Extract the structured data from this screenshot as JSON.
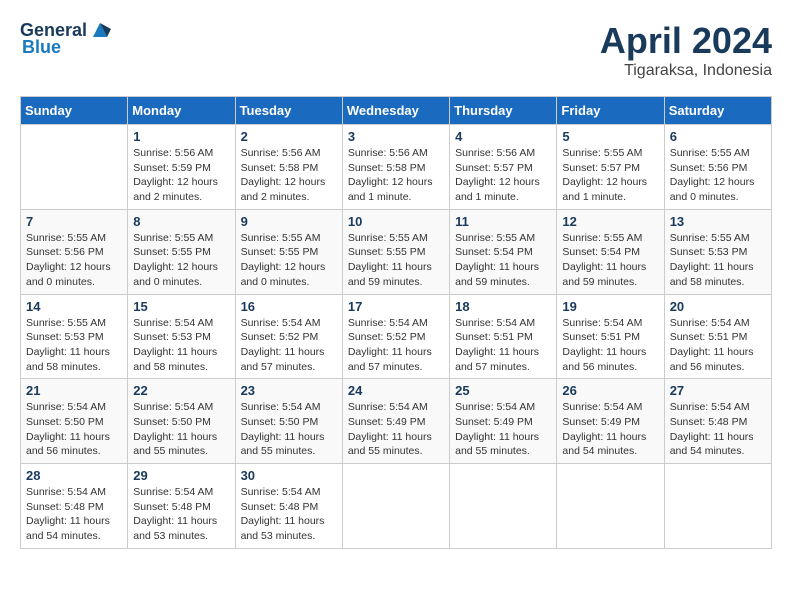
{
  "header": {
    "logo_general": "General",
    "logo_blue": "Blue",
    "month_year": "April 2024",
    "location": "Tigaraksa, Indonesia"
  },
  "days_of_week": [
    "Sunday",
    "Monday",
    "Tuesday",
    "Wednesday",
    "Thursday",
    "Friday",
    "Saturday"
  ],
  "weeks": [
    [
      {
        "day": "",
        "info": ""
      },
      {
        "day": "1",
        "info": "Sunrise: 5:56 AM\nSunset: 5:59 PM\nDaylight: 12 hours\nand 2 minutes."
      },
      {
        "day": "2",
        "info": "Sunrise: 5:56 AM\nSunset: 5:58 PM\nDaylight: 12 hours\nand 2 minutes."
      },
      {
        "day": "3",
        "info": "Sunrise: 5:56 AM\nSunset: 5:58 PM\nDaylight: 12 hours\nand 1 minute."
      },
      {
        "day": "4",
        "info": "Sunrise: 5:56 AM\nSunset: 5:57 PM\nDaylight: 12 hours\nand 1 minute."
      },
      {
        "day": "5",
        "info": "Sunrise: 5:55 AM\nSunset: 5:57 PM\nDaylight: 12 hours\nand 1 minute."
      },
      {
        "day": "6",
        "info": "Sunrise: 5:55 AM\nSunset: 5:56 PM\nDaylight: 12 hours\nand 0 minutes."
      }
    ],
    [
      {
        "day": "7",
        "info": "Sunrise: 5:55 AM\nSunset: 5:56 PM\nDaylight: 12 hours\nand 0 minutes."
      },
      {
        "day": "8",
        "info": "Sunrise: 5:55 AM\nSunset: 5:55 PM\nDaylight: 12 hours\nand 0 minutes."
      },
      {
        "day": "9",
        "info": "Sunrise: 5:55 AM\nSunset: 5:55 PM\nDaylight: 12 hours\nand 0 minutes."
      },
      {
        "day": "10",
        "info": "Sunrise: 5:55 AM\nSunset: 5:55 PM\nDaylight: 11 hours\nand 59 minutes."
      },
      {
        "day": "11",
        "info": "Sunrise: 5:55 AM\nSunset: 5:54 PM\nDaylight: 11 hours\nand 59 minutes."
      },
      {
        "day": "12",
        "info": "Sunrise: 5:55 AM\nSunset: 5:54 PM\nDaylight: 11 hours\nand 59 minutes."
      },
      {
        "day": "13",
        "info": "Sunrise: 5:55 AM\nSunset: 5:53 PM\nDaylight: 11 hours\nand 58 minutes."
      }
    ],
    [
      {
        "day": "14",
        "info": "Sunrise: 5:55 AM\nSunset: 5:53 PM\nDaylight: 11 hours\nand 58 minutes."
      },
      {
        "day": "15",
        "info": "Sunrise: 5:54 AM\nSunset: 5:53 PM\nDaylight: 11 hours\nand 58 minutes."
      },
      {
        "day": "16",
        "info": "Sunrise: 5:54 AM\nSunset: 5:52 PM\nDaylight: 11 hours\nand 57 minutes."
      },
      {
        "day": "17",
        "info": "Sunrise: 5:54 AM\nSunset: 5:52 PM\nDaylight: 11 hours\nand 57 minutes."
      },
      {
        "day": "18",
        "info": "Sunrise: 5:54 AM\nSunset: 5:51 PM\nDaylight: 11 hours\nand 57 minutes."
      },
      {
        "day": "19",
        "info": "Sunrise: 5:54 AM\nSunset: 5:51 PM\nDaylight: 11 hours\nand 56 minutes."
      },
      {
        "day": "20",
        "info": "Sunrise: 5:54 AM\nSunset: 5:51 PM\nDaylight: 11 hours\nand 56 minutes."
      }
    ],
    [
      {
        "day": "21",
        "info": "Sunrise: 5:54 AM\nSunset: 5:50 PM\nDaylight: 11 hours\nand 56 minutes."
      },
      {
        "day": "22",
        "info": "Sunrise: 5:54 AM\nSunset: 5:50 PM\nDaylight: 11 hours\nand 55 minutes."
      },
      {
        "day": "23",
        "info": "Sunrise: 5:54 AM\nSunset: 5:50 PM\nDaylight: 11 hours\nand 55 minutes."
      },
      {
        "day": "24",
        "info": "Sunrise: 5:54 AM\nSunset: 5:49 PM\nDaylight: 11 hours\nand 55 minutes."
      },
      {
        "day": "25",
        "info": "Sunrise: 5:54 AM\nSunset: 5:49 PM\nDaylight: 11 hours\nand 55 minutes."
      },
      {
        "day": "26",
        "info": "Sunrise: 5:54 AM\nSunset: 5:49 PM\nDaylight: 11 hours\nand 54 minutes."
      },
      {
        "day": "27",
        "info": "Sunrise: 5:54 AM\nSunset: 5:48 PM\nDaylight: 11 hours\nand 54 minutes."
      }
    ],
    [
      {
        "day": "28",
        "info": "Sunrise: 5:54 AM\nSunset: 5:48 PM\nDaylight: 11 hours\nand 54 minutes."
      },
      {
        "day": "29",
        "info": "Sunrise: 5:54 AM\nSunset: 5:48 PM\nDaylight: 11 hours\nand 53 minutes."
      },
      {
        "day": "30",
        "info": "Sunrise: 5:54 AM\nSunset: 5:48 PM\nDaylight: 11 hours\nand 53 minutes."
      },
      {
        "day": "",
        "info": ""
      },
      {
        "day": "",
        "info": ""
      },
      {
        "day": "",
        "info": ""
      },
      {
        "day": "",
        "info": ""
      }
    ]
  ]
}
